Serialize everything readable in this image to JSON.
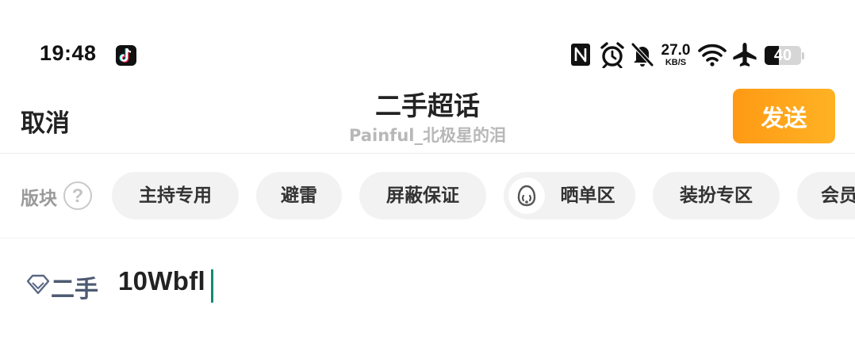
{
  "status_bar": {
    "time": "19:48",
    "app_icon": "tiktok-icon",
    "icons": [
      "nfc-icon",
      "alarm-icon",
      "bell-muted-icon",
      "wifi-icon",
      "airplane-icon"
    ],
    "net_speed_value": "27.0",
    "net_speed_unit": "KB/S",
    "battery_level": "40",
    "battery_fraction": 0.4
  },
  "header": {
    "cancel_label": "取消",
    "title": "二手超话",
    "subtitle": "Painful_北极星的泪",
    "send_label": "发送",
    "send_color": "#ff9a14"
  },
  "sections": {
    "label": "版块",
    "help_icon": "?",
    "chips": [
      {
        "label": "主持专用"
      },
      {
        "label": "避雷"
      },
      {
        "label": "屏蔽保证"
      },
      {
        "label": "晒单区",
        "icon": "cute-face-icon"
      },
      {
        "label": "装扮专区"
      },
      {
        "label": "会员"
      }
    ]
  },
  "compose": {
    "topic_icon": "diamond-icon",
    "topic_tag": "二手",
    "text": "10Wbfl",
    "caret_color": "#138a73"
  }
}
